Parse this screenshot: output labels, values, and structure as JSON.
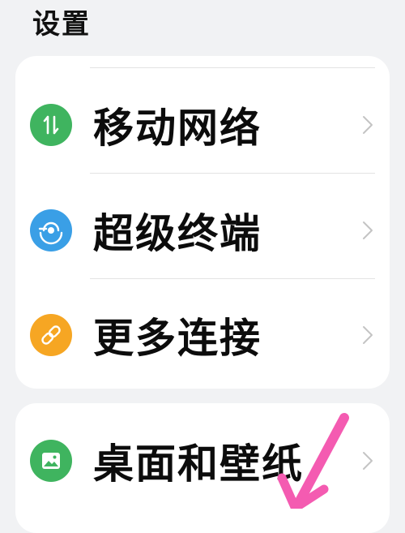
{
  "header": {
    "title": "设置"
  },
  "groups": [
    {
      "items": [
        {
          "label": "移动网络",
          "icon": "mobile-network-icon",
          "color": "#3fb45f"
        },
        {
          "label": "超级终端",
          "icon": "super-device-icon",
          "color": "#3a9fe6"
        },
        {
          "label": "更多连接",
          "icon": "link-icon",
          "color": "#f6a623"
        }
      ]
    },
    {
      "items": [
        {
          "label": "桌面和壁纸",
          "icon": "wallpaper-icon",
          "color": "#3fb45f"
        }
      ]
    }
  ],
  "colors": {
    "background": "#f1f2f4",
    "card": "#ffffff",
    "annotation_arrow": "#f45bb1"
  }
}
